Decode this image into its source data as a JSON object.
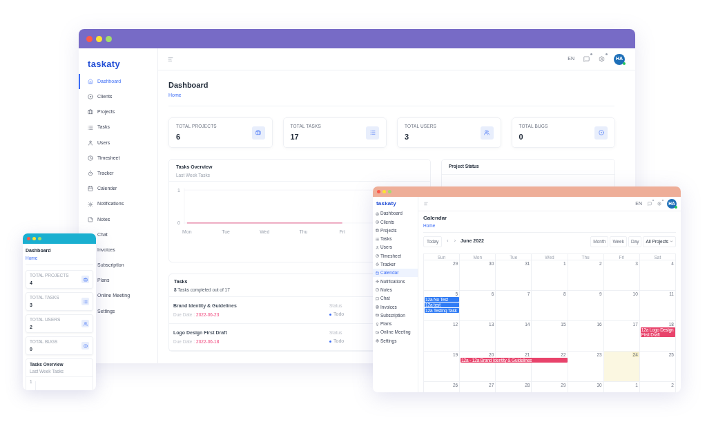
{
  "main_window": {
    "logo": "taskaty",
    "sidebar": {
      "items": [
        {
          "label": "Dashboard",
          "selected": true
        },
        {
          "label": "Clients",
          "selected": false
        },
        {
          "label": "Projects",
          "selected": false
        },
        {
          "label": "Tasks",
          "selected": false
        },
        {
          "label": "Users",
          "selected": false
        },
        {
          "label": "Timesheet",
          "selected": false
        },
        {
          "label": "Tracker",
          "selected": false
        },
        {
          "label": "Calender",
          "selected": false
        },
        {
          "label": "Notifications",
          "selected": false
        },
        {
          "label": "Notes",
          "selected": false
        },
        {
          "label": "Chat",
          "selected": false
        },
        {
          "label": "Invoices",
          "selected": false
        },
        {
          "label": "Subscription",
          "selected": false
        },
        {
          "label": "Plans",
          "selected": false
        },
        {
          "label": "Online Meeting",
          "selected": false
        },
        {
          "label": "Settings",
          "selected": false
        }
      ]
    },
    "topbar": {
      "language": "EN",
      "avatar": "HA"
    },
    "page": {
      "title": "Dashboard",
      "breadcrumb": "Home"
    },
    "stats": [
      {
        "label": "TOTAL PROJECTS",
        "value": "6"
      },
      {
        "label": "TOTAL TASKS",
        "value": "17"
      },
      {
        "label": "TOTAL USERS",
        "value": "3"
      },
      {
        "label": "TOTAL BUGS",
        "value": "0"
      }
    ],
    "tasks_overview": {
      "title": "Tasks Overview",
      "subtitle": "Last Week Tasks",
      "chart_data": {
        "type": "line",
        "categories": [
          "Mon",
          "Tue",
          "Wed",
          "Thu",
          "Fri"
        ],
        "ylim": [
          0,
          1
        ],
        "yticks": [
          0,
          1
        ],
        "series": [
          {
            "color": "#e6789e",
            "values": [
              0,
              0,
              0,
              0,
              0
            ]
          }
        ]
      }
    },
    "project_status": {
      "title": "Project Status"
    },
    "tasks": {
      "title": "Tasks",
      "summary": "**8** Tasks completed out of 17",
      "items": [
        {
          "title": "Brand Identity & Guidelines",
          "due_label": "Due Date :",
          "due_date": "2022-06-23",
          "status_label": "Status",
          "status": "Todo"
        },
        {
          "title": "Logo Design First Draft",
          "due_label": "Due Date :",
          "due_date": "2022-06-18",
          "status_label": "Status",
          "status": "Todo"
        }
      ]
    }
  },
  "calendar_window": {
    "logo": "taskaty",
    "sidebar": {
      "items": [
        {
          "label": "Dashboard",
          "selected": false
        },
        {
          "label": "Clients",
          "selected": false
        },
        {
          "label": "Projects",
          "selected": false
        },
        {
          "label": "Tasks",
          "selected": false
        },
        {
          "label": "Users",
          "selected": false
        },
        {
          "label": "Timesheet",
          "selected": false
        },
        {
          "label": "Tracker",
          "selected": false
        },
        {
          "label": "Calendar",
          "selected": true
        },
        {
          "label": "Notifications",
          "selected": false
        },
        {
          "label": "Notes",
          "selected": false
        },
        {
          "label": "Chat",
          "selected": false
        },
        {
          "label": "Invoices",
          "selected": false
        },
        {
          "label": "Subscription",
          "selected": false
        },
        {
          "label": "Plans",
          "selected": false
        },
        {
          "label": "Online Meeting",
          "selected": false
        },
        {
          "label": "Settings",
          "selected": false
        }
      ]
    },
    "topbar": {
      "language": "EN",
      "avatar": "HA"
    },
    "page": {
      "title": "Calendar",
      "breadcrumb": "Home"
    },
    "toolbar": {
      "today": "Today",
      "prev": "‹",
      "next": "›",
      "month_title": "June 2022",
      "views": [
        {
          "label": "Month"
        },
        {
          "label": "Week"
        },
        {
          "label": "Day"
        }
      ],
      "filter": "All Projects"
    },
    "weekdays": [
      "Sun",
      "Mon",
      "Tue",
      "Wed",
      "Thu",
      "Fri",
      "Sat"
    ],
    "weeks": [
      {
        "days": [
          {
            "label": "29",
            "today": false
          },
          {
            "label": "30",
            "today": false
          },
          {
            "label": "31",
            "today": false
          },
          {
            "label": "1",
            "today": false
          },
          {
            "label": "2",
            "today": false
          },
          {
            "label": "3",
            "today": false
          },
          {
            "label": "4",
            "today": false
          }
        ]
      },
      {
        "days": [
          {
            "label": "5",
            "today": false,
            "events": [
              {
                "kind": "event",
                "label": "12a No Test",
                "color": "#2f7bf5"
              },
              {
                "kind": "event",
                "label": "12a test",
                "color": "#2f7bf5"
              },
              {
                "kind": "event",
                "label": "12a Testing Task",
                "color": "#2f7bf5"
              }
            ]
          },
          {
            "label": "6",
            "today": false
          },
          {
            "label": "7",
            "today": false
          },
          {
            "label": "8",
            "today": false
          },
          {
            "label": "9",
            "today": false
          },
          {
            "label": "10",
            "today": false
          },
          {
            "label": "11",
            "today": false
          }
        ]
      },
      {
        "days": [
          {
            "label": "12",
            "today": false
          },
          {
            "label": "13",
            "today": false
          },
          {
            "label": "14",
            "today": false
          },
          {
            "label": "15",
            "today": false
          },
          {
            "label": "16",
            "today": false
          },
          {
            "label": "17",
            "today": false
          },
          {
            "label": "18",
            "today": false,
            "events": [
              {
                "kind": "event",
                "label": "12a Logo Design First Draft",
                "color": "#e8436b"
              }
            ]
          }
        ]
      },
      {
        "days": [
          {
            "label": "19",
            "today": false
          },
          {
            "label": "20",
            "today": false,
            "events": [
              {
                "kind": "event",
                "label": "12a - 12a Brand Identity & Guidelines",
                "color": "#e8436b"
              }
            ]
          },
          {
            "label": "21",
            "today": false,
            "events": [
              {
                "kind": "continuation"
              }
            ]
          },
          {
            "label": "22",
            "today": false,
            "events": [
              {
                "kind": "continuation"
              }
            ]
          },
          {
            "label": "23",
            "today": false
          },
          {
            "label": "24",
            "today": true
          },
          {
            "label": "25",
            "today": false
          }
        ]
      },
      {
        "days": [
          {
            "label": "26",
            "today": false
          },
          {
            "label": "27",
            "today": false
          },
          {
            "label": "28",
            "today": false
          },
          {
            "label": "29",
            "today": false
          },
          {
            "label": "30",
            "today": false
          },
          {
            "label": "1",
            "today": false
          },
          {
            "label": "2",
            "today": false
          }
        ]
      }
    ]
  },
  "phone_window": {
    "page": {
      "title": "Dashboard",
      "breadcrumb": "Home"
    },
    "stats": [
      {
        "label": "TOTAL PROJECTS",
        "value": "4"
      },
      {
        "label": "TOTAL TASKS",
        "value": "3"
      },
      {
        "label": "TOTAL USERS",
        "value": "2"
      },
      {
        "label": "TOTAL BUGS",
        "value": "0"
      }
    ],
    "tasks_overview": {
      "title": "Tasks Overview",
      "subtitle": "Last Week Tasks",
      "tick": "1"
    }
  }
}
